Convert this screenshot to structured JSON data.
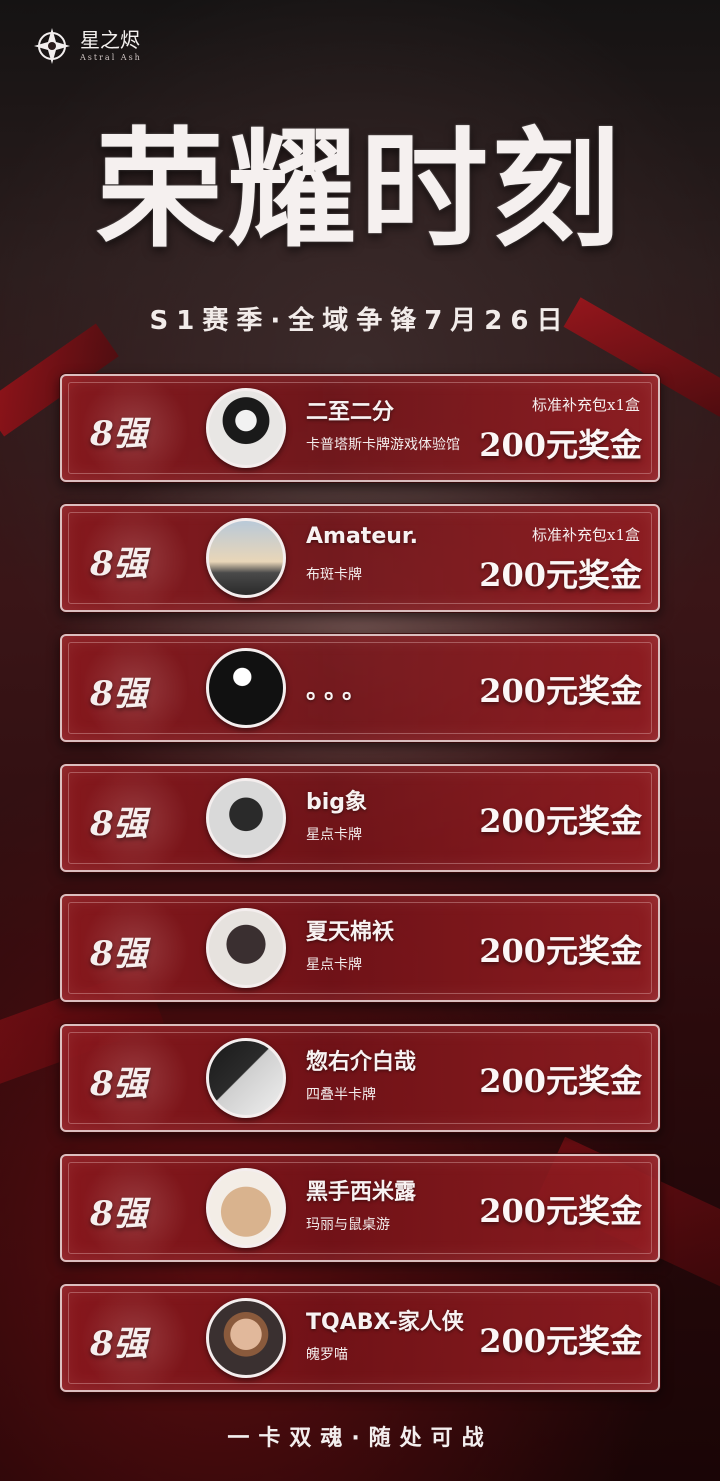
{
  "brand": {
    "name": "星之烬",
    "subtitle": "Astral Ash"
  },
  "hero": {
    "title": "荣耀时刻",
    "subtitle": "S1赛季·全域争锋7月26日"
  },
  "cards": [
    {
      "rank": "8强",
      "name": "二至二分",
      "team": "卡普塔斯卡牌游戏体验馆",
      "prize_pack": "标准补充包x1盒",
      "prize_cash": "200元奖金"
    },
    {
      "rank": "8强",
      "name": "Amateur.",
      "team": "布斑卡牌",
      "prize_pack": "标准补充包x1盒",
      "prize_cash": "200元奖金"
    },
    {
      "rank": "8强",
      "name": "。。。",
      "team": "",
      "prize_cash": "200元奖金"
    },
    {
      "rank": "8强",
      "name": "big象",
      "team": "星点卡牌",
      "prize_cash": "200元奖金"
    },
    {
      "rank": "8强",
      "name": "夏天棉袄",
      "team": "星点卡牌",
      "prize_cash": "200元奖金"
    },
    {
      "rank": "8强",
      "name": "惣右介白哉",
      "team": "四叠半卡牌",
      "prize_cash": "200元奖金"
    },
    {
      "rank": "8强",
      "name": "黑手西米露",
      "team": "玛丽与鼠桌游",
      "prize_cash": "200元奖金"
    },
    {
      "rank": "8强",
      "name": "TQABX-家人侠",
      "team": "魄罗喵",
      "prize_cash": "200元奖金"
    }
  ],
  "footer": {
    "slogan": "一卡双魂·随处可战"
  }
}
